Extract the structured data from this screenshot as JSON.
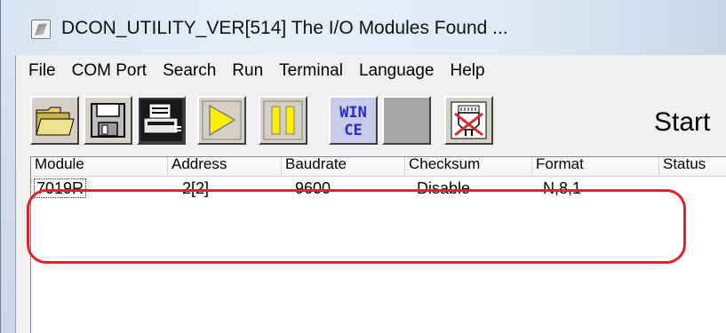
{
  "window": {
    "title": "DCON_UTILITY_VER[514] The I/O Modules Found ..."
  },
  "menu": {
    "items": [
      "File",
      "COM Port",
      "Search",
      "Run",
      "Terminal",
      "Language",
      "Help"
    ]
  },
  "toolbar": {
    "buttons": [
      {
        "name": "open-folder-icon"
      },
      {
        "name": "save-disk-icon"
      },
      {
        "name": "printer-icon"
      },
      {
        "name": "play-icon"
      },
      {
        "name": "pause-icon"
      },
      {
        "name": "wince-icon",
        "label": "WIN\nCE"
      },
      {
        "name": "blank-button-icon"
      },
      {
        "name": "disconnect-port-icon"
      }
    ],
    "wince_line1": "WIN",
    "wince_line2": "CE",
    "start_label": "Start"
  },
  "list": {
    "columns": [
      "Module",
      "Address",
      "Baudrate",
      "Checksum",
      "Format",
      "Status"
    ],
    "rows": [
      {
        "module": "7019R",
        "address": "2[2]",
        "baudrate": "9600",
        "checksum": "Disable",
        "format": "N,8,1",
        "status": ""
      }
    ]
  },
  "colors": {
    "highlight": "#e8202a",
    "toolbar_face": "#d4d0c8"
  }
}
